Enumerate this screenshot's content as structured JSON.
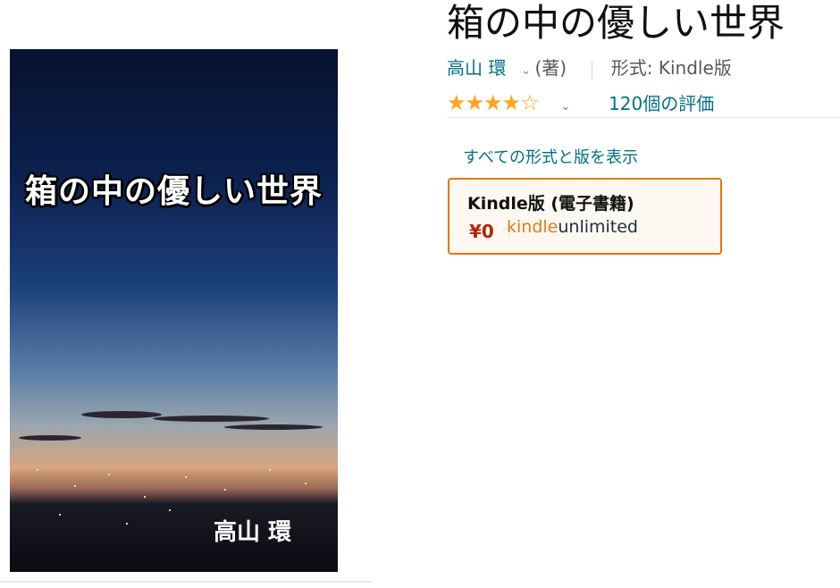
{
  "cover": {
    "title": "箱の中の優しい世界",
    "author": "高山 環"
  },
  "product": {
    "title": "箱の中の優しい世界",
    "author_name": "高山 環",
    "author_role": "(著)",
    "format_label": "形式: Kindle版",
    "stars": "★★★★☆",
    "rating_value": 4,
    "ratings_count": "120個の評価",
    "all_formats_link": "すべての形式と版を表示"
  },
  "format_card": {
    "name": "Kindle版 (電子書籍)",
    "price": "¥0",
    "ku_kindle": "kindle",
    "ku_unlimited": "unlimited"
  },
  "icons": {
    "author_dropdown": "chevron-down-icon",
    "rating_dropdown": "chevron-down-icon"
  },
  "colors": {
    "link": "#007185",
    "star": "#ffa41c",
    "price": "#b12704",
    "selected_border": "#e77600"
  }
}
